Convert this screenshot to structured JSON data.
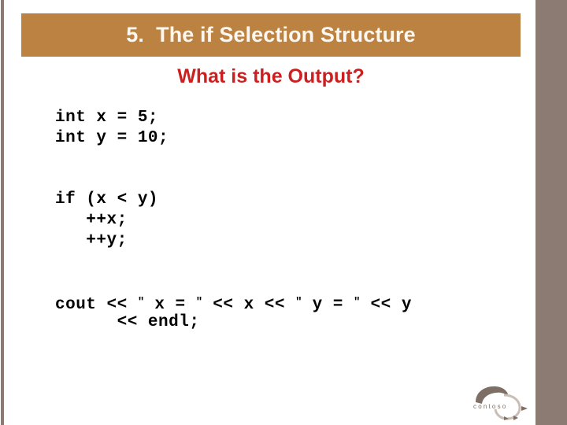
{
  "slide": {
    "title": "5.  The if Selection Structure",
    "subtitle": "What is the Output?",
    "code_lines": [
      "int x = 5;",
      "int y = 10;",
      "",
      "if (x < y)",
      "   ++x;",
      "   ++y;",
      "",
      "cout << \" x = \" << x << \" y = \" << y",
      "      << endl;"
    ],
    "code": {
      "line1": "int x = 5;",
      "line2": "int y = 10;",
      "line3": "",
      "line4": "if (x < y)",
      "line5": "   ++x;",
      "line6": "   ++y;",
      "line7": "",
      "line8_a": "cout << ",
      "line8_q1": "\"",
      "line8_b": " x = ",
      "line8_q2": "\"",
      "line8_c": " << x << ",
      "line8_q3": "\"",
      "line8_d": " y = ",
      "line8_q4": "\"",
      "line8_e": " << y",
      "line9": "      << endl;"
    }
  },
  "logo": {
    "brand": "contoso",
    "name": "contoso-logo"
  },
  "colors": {
    "title_bar": "#BC8241",
    "title_text": "#FDF7EF",
    "subtitle_text": "#CC1F1F",
    "right_panel": "#8B7B72",
    "left_stripe": "#8B7A71",
    "code_text": "#000000",
    "background": "#FFFFFF",
    "logo": "#7D6E66"
  }
}
